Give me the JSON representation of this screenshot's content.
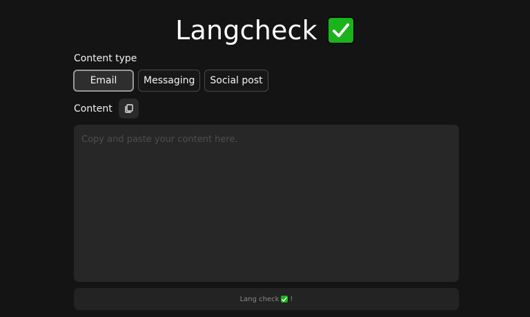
{
  "header": {
    "title": "Langcheck",
    "title_icon": "check-mark-button-icon"
  },
  "content_type": {
    "label": "Content type",
    "options": [
      "Email",
      "Messaging",
      "Social post"
    ],
    "selected": "Email"
  },
  "content": {
    "label": "Content",
    "copy_icon": "copy-icon",
    "placeholder": "Copy and paste your content here.",
    "value": ""
  },
  "submit": {
    "label": "Lang check",
    "suffix": "!",
    "icon": "check-mark-button-icon"
  },
  "colors": {
    "background": "#141414",
    "accent_green": "#1bb31b",
    "textarea_bg": "#272727",
    "button_bg": "#232323"
  }
}
